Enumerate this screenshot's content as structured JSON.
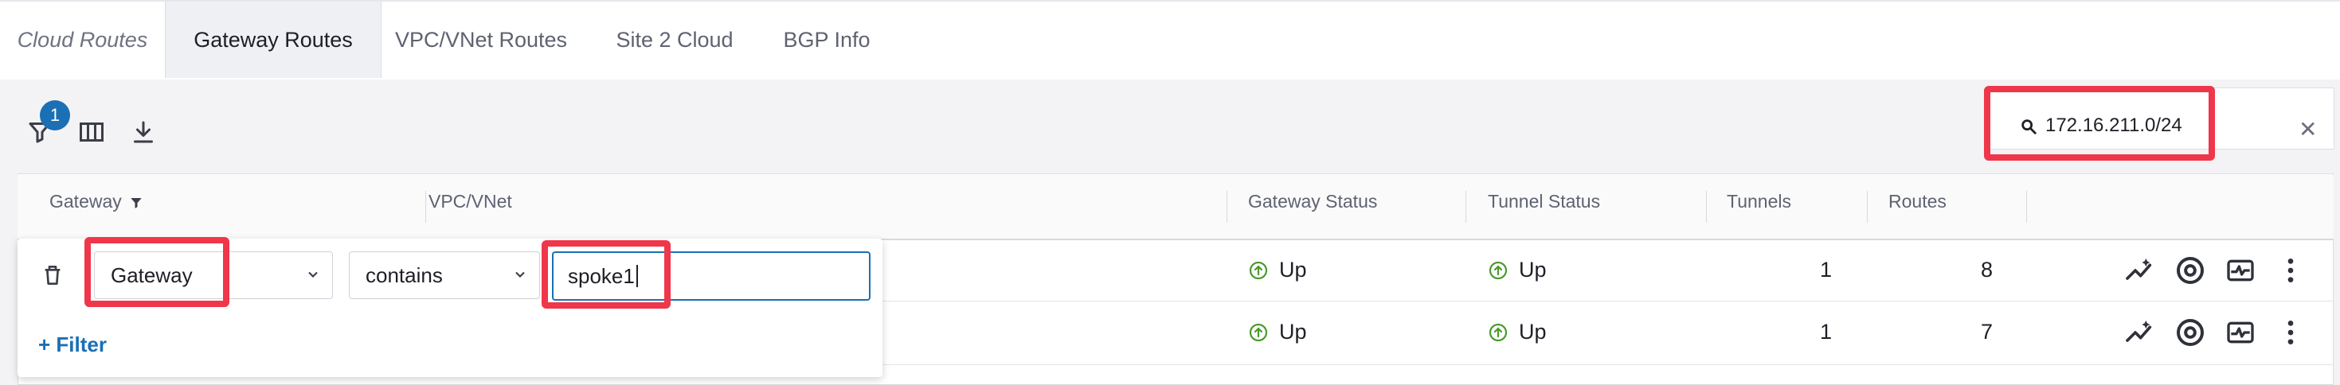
{
  "tabs": [
    {
      "label": "Cloud Routes"
    },
    {
      "label": "Gateway Routes"
    },
    {
      "label": "VPC/VNet Routes"
    },
    {
      "label": "Site 2 Cloud"
    },
    {
      "label": "BGP Info"
    }
  ],
  "toolbar": {
    "filter_badge": "1",
    "icons": [
      "filter-icon",
      "columns-icon",
      "download-icon"
    ]
  },
  "search": {
    "value": "172.16.211.0/24",
    "icon": "search-icon",
    "clear_icon": "close-icon"
  },
  "table": {
    "columns": [
      "Gateway",
      "VPC/VNet",
      "Gateway Status",
      "Tunnel Status",
      "Tunnels",
      "Routes"
    ],
    "rows": [
      {
        "gateway_status": "Up",
        "tunnel_status": "Up",
        "tunnels": "1",
        "routes": "8"
      },
      {
        "gateway_status": "Up",
        "tunnel_status": "Up",
        "tunnels": "1",
        "routes": "7"
      }
    ],
    "row_actions": [
      "analytics-icon",
      "at-sign-icon",
      "diagnostics-icon",
      "more-vertical-icon"
    ]
  },
  "filter_panel": {
    "field": "Gateway",
    "operator": "contains",
    "value": "spoke1",
    "add_label": "+ Filter"
  },
  "colors": {
    "accent": "#1a6fb5",
    "status_up": "#4a9a2c",
    "highlight": "#f0364a"
  }
}
